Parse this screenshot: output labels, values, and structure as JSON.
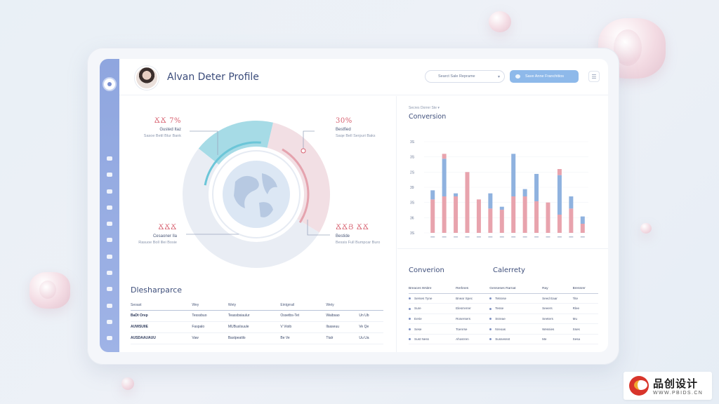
{
  "header": {
    "title": "Alvan Deter Profile",
    "select_label": "Searct Sale Reprame",
    "button_label": "Save Anne Franchitios",
    "menu_icon": "list-icon"
  },
  "sidebar": {
    "icons": [
      "logo-icon",
      "pin-icon",
      "clock-icon",
      "card-icon",
      "list-icon",
      "link-icon",
      "cloud-icon",
      "settings-icon",
      "edit-icon",
      "menu-icon",
      "chart-icon",
      "grid-icon",
      "database-icon"
    ]
  },
  "donut": {
    "segments": [
      {
        "name": "teal",
        "value": 18,
        "color": "#a6dbe6"
      },
      {
        "name": "pink",
        "value": 30,
        "color": "#f2dfe4"
      },
      {
        "name": "grey",
        "value": 52,
        "color": "#e9edf4"
      }
    ],
    "callouts": [
      {
        "val": "ՃՃ 7%",
        "lbl": "Gusted Itaz",
        "txt": "Sasoe Betil Blur Bank"
      },
      {
        "val": "30%",
        "lbl": "Bestfied",
        "txt": "Saqe Bell Serpuri Baks"
      },
      {
        "val": "ՃՃՃ",
        "lbl": "Cesaoner Ila",
        "txt": "Rasuoe Boll Illei Bosie"
      },
      {
        "val": "ՃՃՅ ՃՃ",
        "lbl": "Bestide",
        "txt": "Bessis Full Bumpcar Buro"
      }
    ]
  },
  "dispersion": {
    "title": "Dlesharparce",
    "columns": [
      "Seoast",
      "Wey",
      "Wety",
      "Eintgrrail",
      "Wety"
    ],
    "rows": [
      [
        "BaDt Orep",
        "Tesssbuo",
        "Teassbsiaulur",
        "Ossetbs-Tet",
        "Waibsao",
        "Un Ub"
      ],
      [
        "AUWSUIIE",
        "Faspalo",
        "MUBusIsuule",
        "V Vioib",
        "Ilsaseuu",
        "Ve Qe"
      ],
      [
        "AUSDAAUAUU",
        "Vaw",
        "Bastpeatilo",
        "Be Ve",
        "Ttalr",
        "Uu Ua"
      ]
    ]
  },
  "conversion_chart": {
    "subtitle": "Secres Dorrer Ste",
    "title": "Conversion"
  },
  "chart_data": {
    "type": "bar",
    "title": "Conversion",
    "stacked": true,
    "y_ticks": [
      "3S",
      "36",
      "3S",
      "39",
      "2S",
      "3S",
      "3S"
    ],
    "categories": [
      "",
      "",
      "",
      "",
      "",
      "",
      "",
      "",
      "",
      "",
      "",
      "",
      "",
      ""
    ],
    "series": [
      {
        "color": "#e8a3ad",
        "values": [
          55,
          60,
          60,
          100,
          55,
          40,
          38,
          60,
          60,
          52,
          50,
          30,
          40,
          15
        ]
      },
      {
        "color": "#8fb2df",
        "values": [
          15,
          62,
          5,
          0,
          0,
          25,
          5,
          70,
          12,
          45,
          0,
          65,
          20,
          12
        ]
      },
      {
        "color": "#e8a3ad",
        "values": [
          0,
          8,
          0,
          0,
          0,
          0,
          0,
          0,
          0,
          0,
          0,
          10,
          0,
          0
        ]
      }
    ],
    "ylim": [
      0,
      150
    ]
  },
  "bottom_right": {
    "title_left": "Converion",
    "title_right": "Calerrety",
    "columns": [
      "Breaces Wsitre",
      "Rerbnes",
      "Genseses Rarnat",
      "Ray",
      "Bressrer"
    ],
    "rows": [
      [
        "Serses Tyne",
        "Bnear Spec",
        "Tetsnse",
        "Seed Eaar",
        "Tite"
      ],
      [
        "Sure",
        "Elesrrerrer",
        "Tesse",
        "Seeers",
        "Rlee"
      ],
      [
        "Eerie",
        "Rosersers",
        "Ssreae",
        "Seeters",
        "Mu"
      ],
      [
        "Sese",
        "Toenrse",
        "Nreoas",
        "Wessies",
        "Sses"
      ],
      [
        "Sust Ness",
        "Ahosrren",
        "Sussessst",
        "Me",
        "Sesa"
      ]
    ]
  },
  "brand": {
    "name": "品创设计",
    "url": "WWW.PBIDS.CN"
  }
}
